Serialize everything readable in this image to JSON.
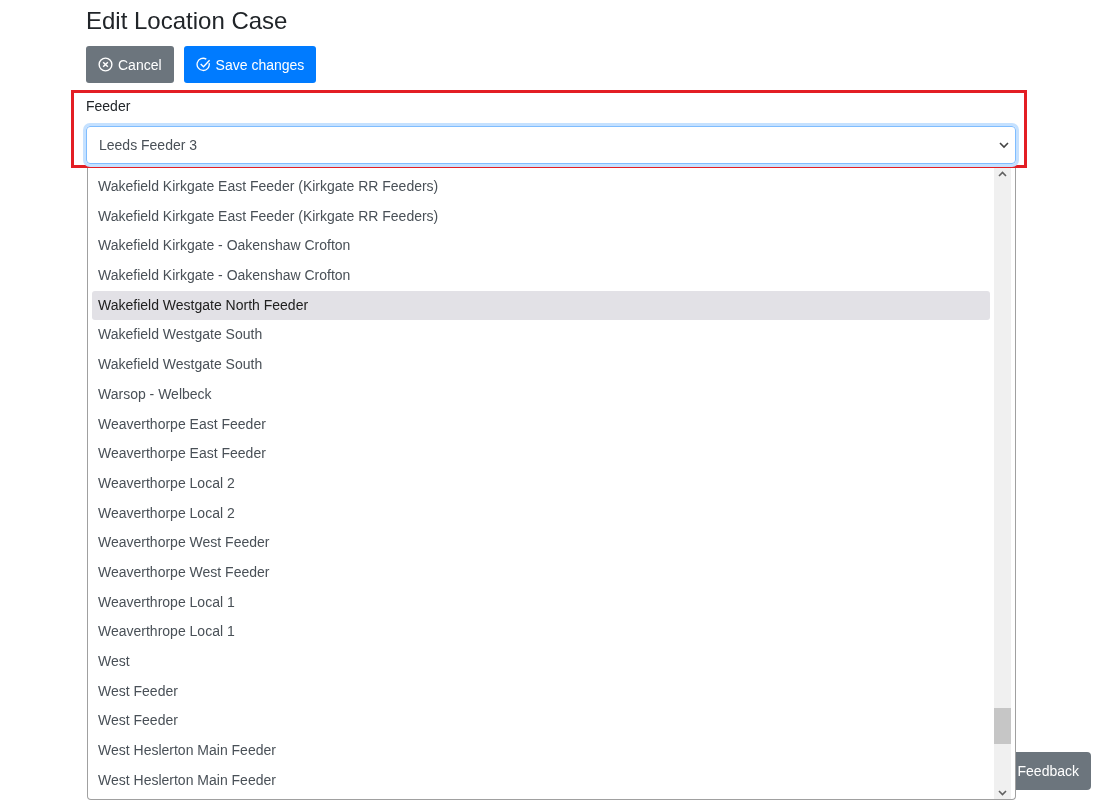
{
  "title": "Edit Location Case",
  "buttons": [
    {
      "kind": "cancel",
      "label": "Cancel"
    },
    {
      "kind": "save",
      "label": "Save changes"
    }
  ],
  "feeder": {
    "label": "Feeder",
    "value": "Leeds Feeder 3",
    "expanded": true,
    "options": [
      {
        "label": "Wakefield Kirkgate East Feeder (Kirkgate RR Feeders)",
        "selected": false
      },
      {
        "label": "Wakefield Kirkgate East Feeder (Kirkgate RR Feeders)",
        "selected": false
      },
      {
        "label": "Wakefield Kirkgate - Oakenshaw Crofton",
        "selected": false
      },
      {
        "label": "Wakefield Kirkgate - Oakenshaw Crofton",
        "selected": false
      },
      {
        "label": "Wakefield Westgate North Feeder",
        "selected": true
      },
      {
        "label": "Wakefield Westgate South",
        "selected": false
      },
      {
        "label": "Wakefield Westgate South",
        "selected": false
      },
      {
        "label": "Warsop - Welbeck",
        "selected": false
      },
      {
        "label": "Weaverthorpe East Feeder",
        "selected": false
      },
      {
        "label": "Weaverthorpe East Feeder",
        "selected": false
      },
      {
        "label": "Weaverthorpe Local 2",
        "selected": false
      },
      {
        "label": "Weaverthorpe Local 2",
        "selected": false
      },
      {
        "label": "Weaverthorpe West Feeder",
        "selected": false
      },
      {
        "label": "Weaverthorpe West Feeder",
        "selected": false
      },
      {
        "label": "Weaverthrope Local 1",
        "selected": false
      },
      {
        "label": "Weaverthrope Local 1",
        "selected": false
      },
      {
        "label": "West",
        "selected": false
      },
      {
        "label": "West Feeder",
        "selected": false
      },
      {
        "label": "West Feeder",
        "selected": false
      },
      {
        "label": "West Heslerton Main Feeder",
        "selected": false
      },
      {
        "label": "West Heslerton Main Feeder",
        "selected": false
      }
    ]
  },
  "feedback": {
    "label": "Feedback"
  }
}
